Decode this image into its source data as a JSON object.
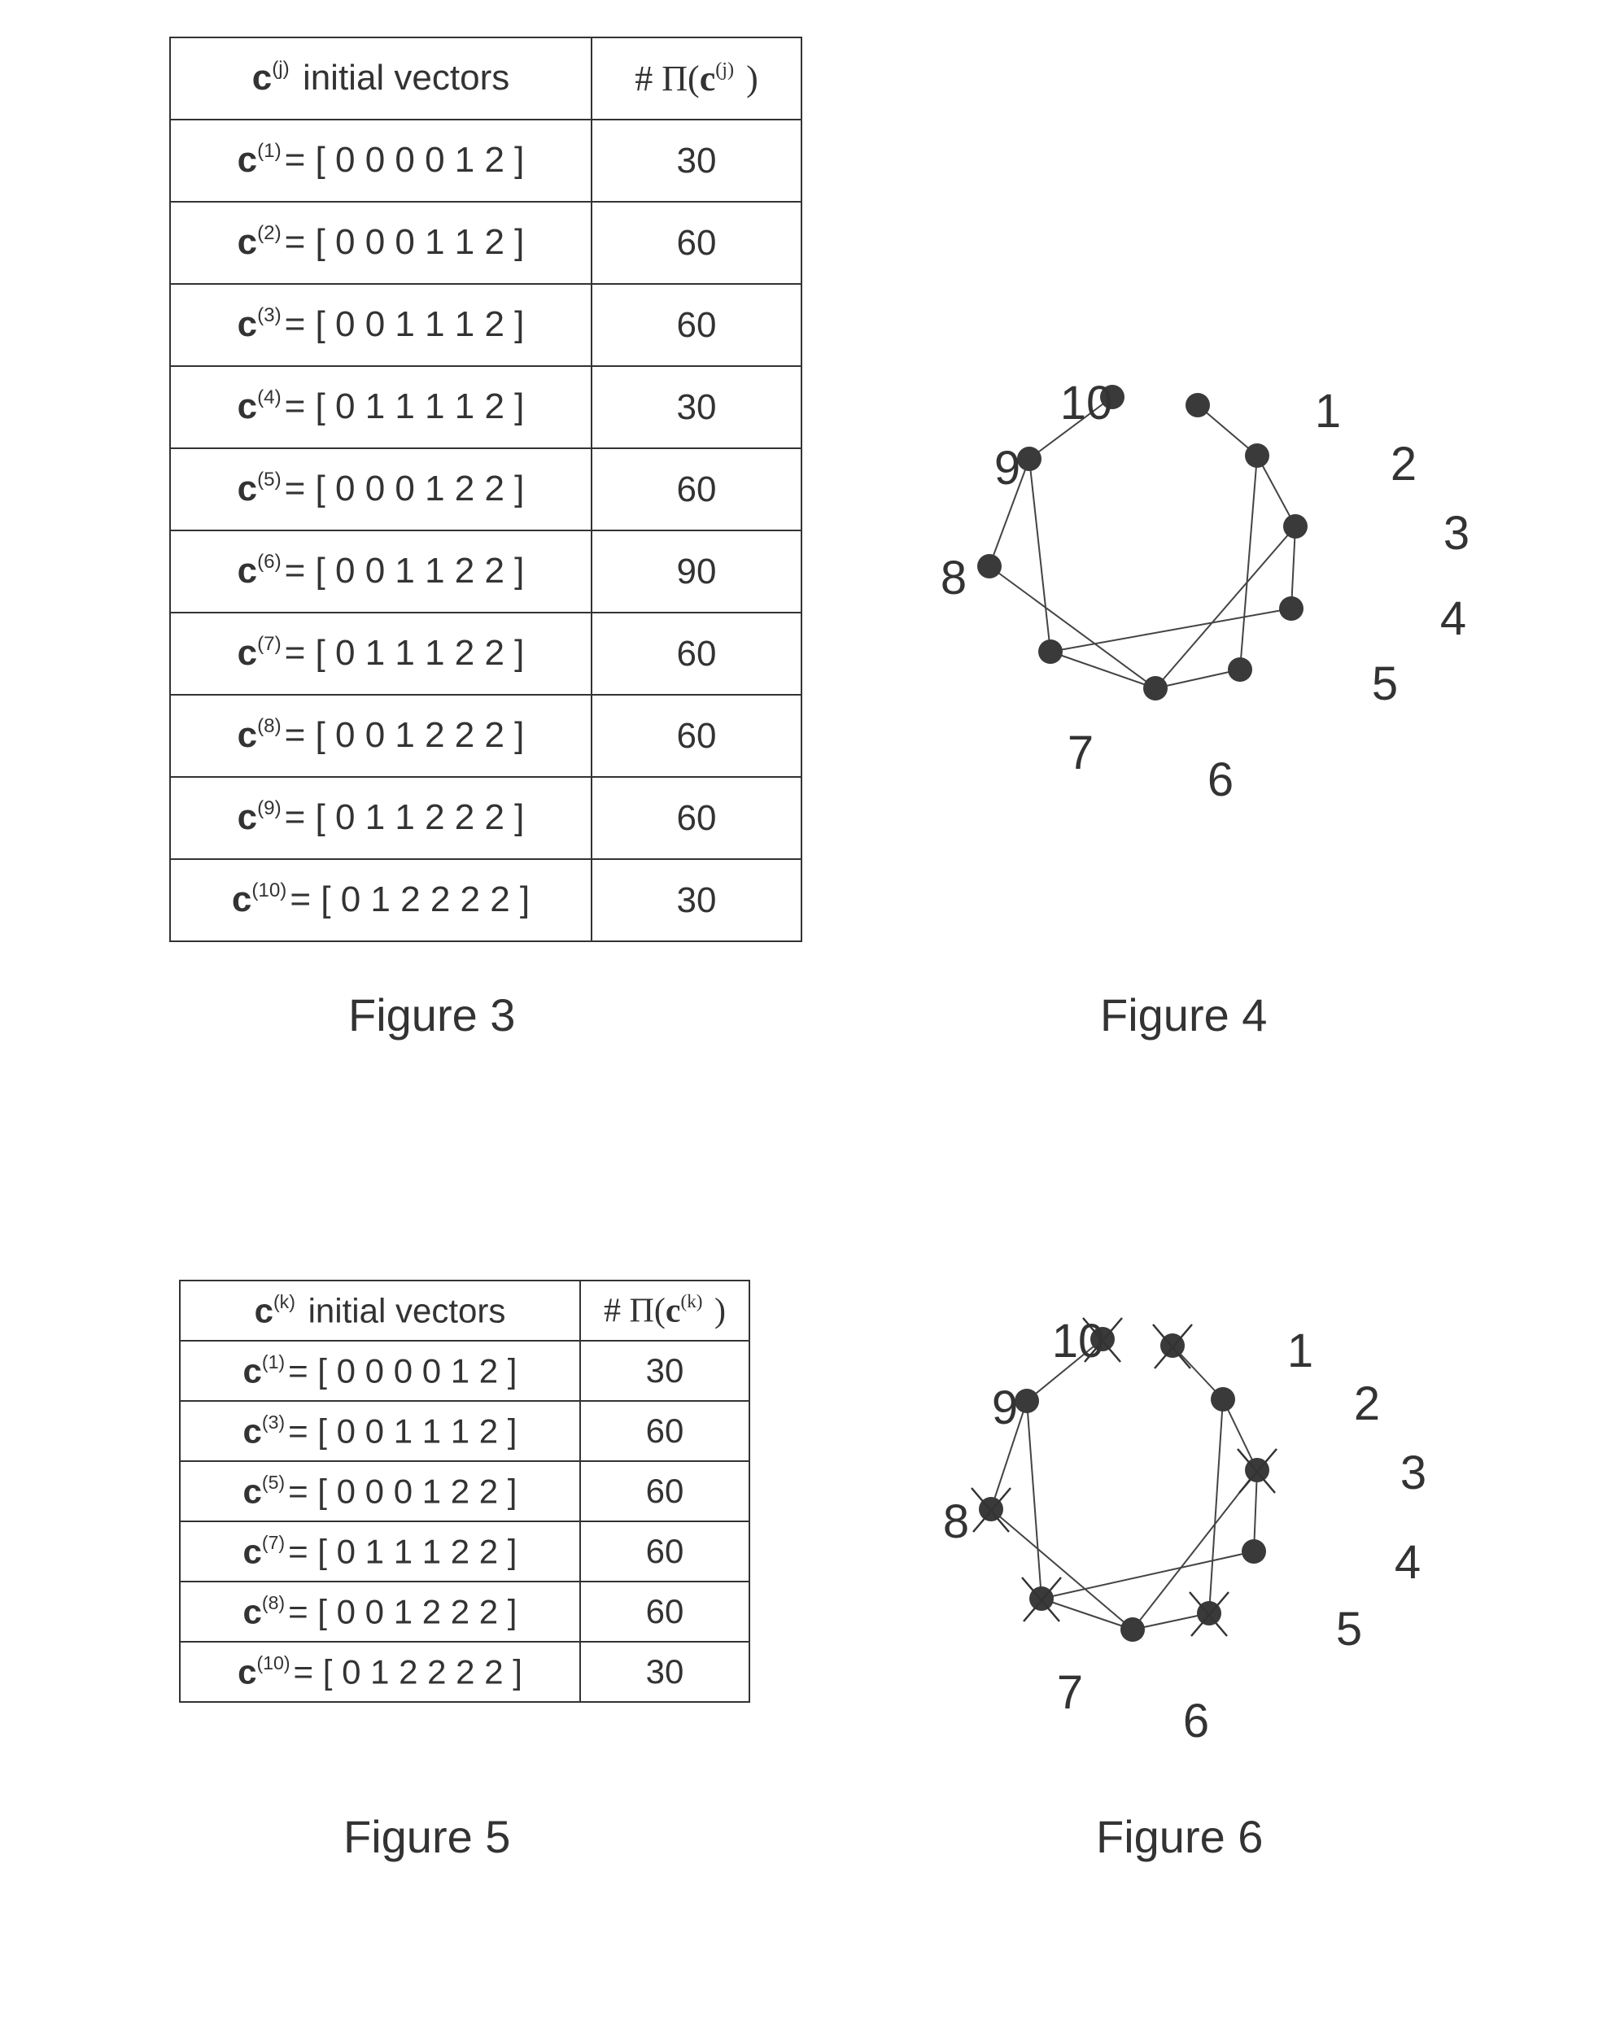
{
  "figure3": {
    "caption": "Figure 3",
    "header": {
      "col1_symbol": "c",
      "col1_index": "(j)",
      "col1_text": "initial vectors",
      "col2_prefix": "# Π(",
      "col2_symbol": "c",
      "col2_index": "(j)",
      "col2_suffix": " )"
    },
    "rows": [
      {
        "index": "(1)",
        "vector": "= [ 0 0 0 0 1 2 ]",
        "count": "30"
      },
      {
        "index": "(2)",
        "vector": "= [ 0 0 0 1 1 2 ]",
        "count": "60"
      },
      {
        "index": "(3)",
        "vector": "= [ 0 0 1 1 1 2 ]",
        "count": "60"
      },
      {
        "index": "(4)",
        "vector": "= [ 0 1 1 1 1 2 ]",
        "count": "30"
      },
      {
        "index": "(5)",
        "vector": "= [ 0 0 0 1 2 2 ]",
        "count": "60"
      },
      {
        "index": "(6)",
        "vector": "= [ 0 0 1 1 2 2 ]",
        "count": "90"
      },
      {
        "index": "(7)",
        "vector": "= [ 0 1 1 1 2 2 ]",
        "count": "60"
      },
      {
        "index": "(8)",
        "vector": "= [ 0 0 1 2 2 2 ]",
        "count": "60"
      },
      {
        "index": "(9)",
        "vector": "= [ 0 1 1 2 2 2 ]",
        "count": "60"
      },
      {
        "index": "(10)",
        "vector": "= [ 0 1 2 2 2 2 ]",
        "count": "30"
      }
    ]
  },
  "figure4": {
    "caption": "Figure 4",
    "nodes": [
      "1",
      "2",
      "3",
      "4",
      "5",
      "6",
      "7",
      "8",
      "9",
      "10"
    ],
    "edges": [
      [
        "10",
        "9"
      ],
      [
        "1",
        "2"
      ],
      [
        "2",
        "3"
      ],
      [
        "2",
        "5"
      ],
      [
        "3",
        "4"
      ],
      [
        "3",
        "6"
      ],
      [
        "9",
        "8"
      ],
      [
        "9",
        "7"
      ],
      [
        "8",
        "6"
      ],
      [
        "7",
        "4"
      ],
      [
        "7",
        "6"
      ],
      [
        "6",
        "5"
      ]
    ],
    "crossed_nodes": []
  },
  "figure5": {
    "caption": "Figure 5",
    "header": {
      "col1_symbol": "c",
      "col1_index": "(k)",
      "col1_text": "initial vectors",
      "col2_prefix": "# Π(",
      "col2_symbol": "c",
      "col2_index": "(k)",
      "col2_suffix": " )"
    },
    "rows": [
      {
        "index": "(1)",
        "vector": "= [ 0 0 0 0 1 2 ]",
        "count": "30"
      },
      {
        "index": "(3)",
        "vector": "= [ 0 0 1 1 1 2 ]",
        "count": "60"
      },
      {
        "index": "(5)",
        "vector": "= [ 0 0 0 1 2 2 ]",
        "count": "60"
      },
      {
        "index": "(7)",
        "vector": "= [ 0 1 1 1 2 2 ]",
        "count": "60"
      },
      {
        "index": "(8)",
        "vector": "= [ 0 0 1 2 2 2 ]",
        "count": "60"
      },
      {
        "index": "(10)",
        "vector": "= [ 0 1 2 2 2 2 ]",
        "count": "30"
      }
    ]
  },
  "figure6": {
    "caption": "Figure 6",
    "nodes": [
      "1",
      "2",
      "3",
      "4",
      "5",
      "6",
      "7",
      "8",
      "9",
      "10"
    ],
    "edges": [
      [
        "10",
        "9"
      ],
      [
        "1",
        "2"
      ],
      [
        "2",
        "3"
      ],
      [
        "2",
        "5"
      ],
      [
        "3",
        "4"
      ],
      [
        "3",
        "6"
      ],
      [
        "9",
        "8"
      ],
      [
        "9",
        "7"
      ],
      [
        "8",
        "6"
      ],
      [
        "7",
        "4"
      ],
      [
        "7",
        "6"
      ],
      [
        "6",
        "5"
      ]
    ],
    "crossed_nodes": [
      "1",
      "3",
      "5",
      "7",
      "8",
      "10"
    ]
  }
}
